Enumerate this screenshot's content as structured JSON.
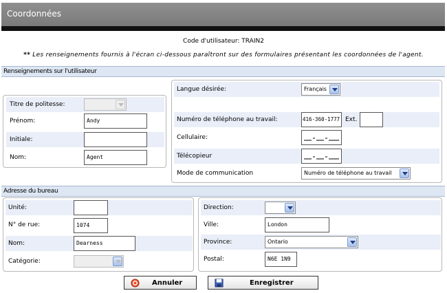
{
  "header": {
    "title": "Coordonnées"
  },
  "user": {
    "code_line": "Code d'utilisateur: TRAIN2"
  },
  "notice": {
    "stars": "**",
    "text": "Les renseignements fournis à l'écran ci-dessous paraîtront sur des formulaires présentant les coordonnées de l'agent."
  },
  "user_section": {
    "title": "Renseignements sur l'utilisateur",
    "politesse": {
      "label": "Titre de politesse:",
      "value": ""
    },
    "prenom": {
      "label": "Prénom:",
      "value": "Andy"
    },
    "initiale": {
      "label": "Initiale:",
      "value": ""
    },
    "nom": {
      "label": "Nom:",
      "value": "Agent"
    },
    "langue": {
      "label": "Langue désirée:",
      "value": "Français"
    },
    "tel_travail": {
      "label": "Numéro de téléphone au travail:",
      "value": "416-360-1777",
      "ext_label": "Ext.",
      "ext_value": ""
    },
    "cellulaire": {
      "label": "Cellulaire:"
    },
    "telecopieur": {
      "label": "Télécopieur"
    },
    "mode": {
      "label": "Mode de communication",
      "value": "Numéro de téléphone au travail"
    }
  },
  "address_section": {
    "title": "Adresse du bureau",
    "unite": {
      "label": "Unité:",
      "value": ""
    },
    "no_rue": {
      "label": "N° de rue:",
      "value": "1074"
    },
    "nom": {
      "label": "Nom:",
      "value": "Dearness"
    },
    "categorie": {
      "label": "Catégorie:",
      "value": ""
    },
    "direction": {
      "label": "Direction:",
      "value": ""
    },
    "ville": {
      "label": "Ville:",
      "value": "London"
    },
    "province": {
      "label": "Province:",
      "value": "Ontario"
    },
    "postal": {
      "label": "Postal:",
      "value": "N6E 1N9"
    }
  },
  "buttons": {
    "cancel": "Annuler",
    "save": "Enregistrer"
  },
  "colors": {
    "header_bg": "#858585",
    "row_bg": "#e9eef8",
    "section_bg": "#dde6f3"
  },
  "icons": {
    "cancel": "cancel-circle-icon",
    "save": "floppy-disk-icon"
  }
}
